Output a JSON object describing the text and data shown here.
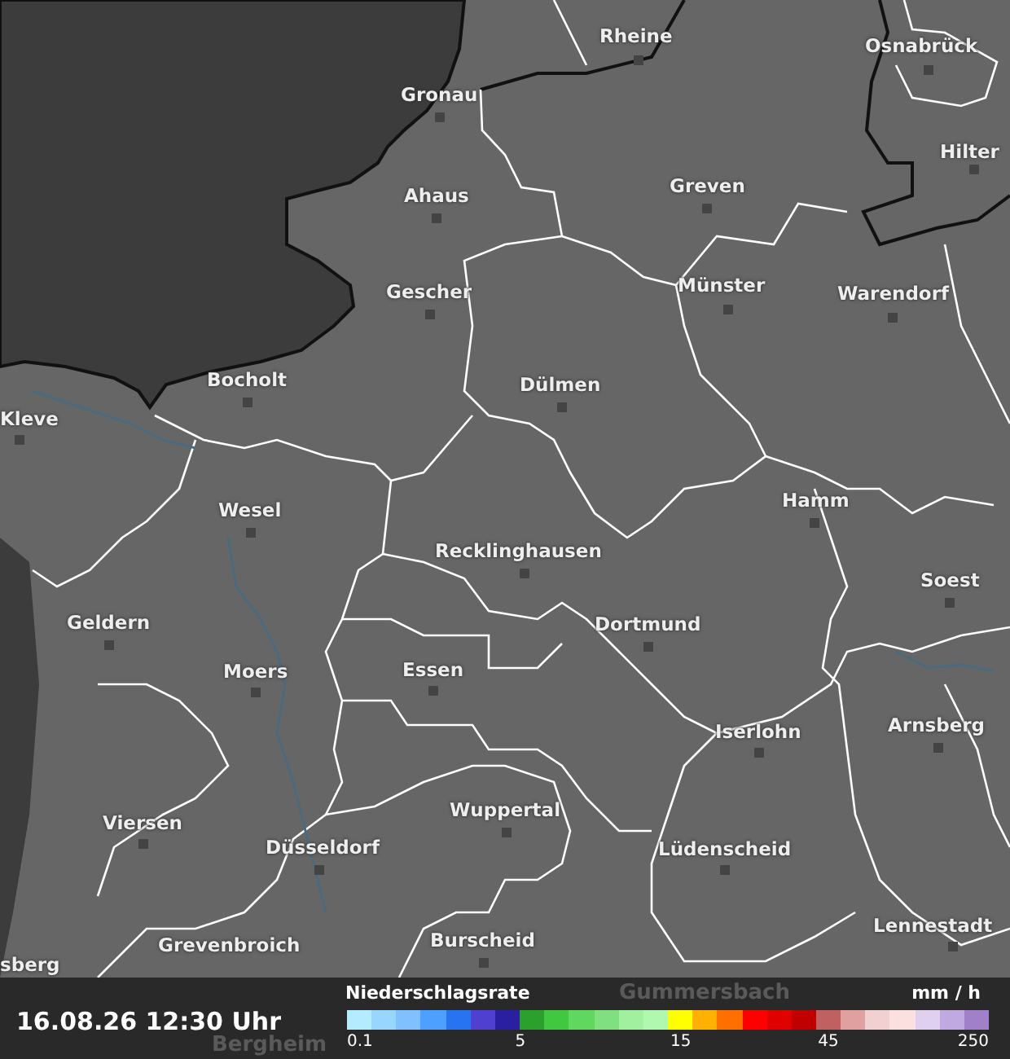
{
  "map": {
    "places": [
      {
        "name": "Rheine",
        "kind": "town"
      },
      {
        "name": "Osnabrück",
        "kind": "town"
      },
      {
        "name": "Gronau",
        "kind": "town"
      },
      {
        "name": "Hilter",
        "kind": "town"
      },
      {
        "name": "Ahaus",
        "kind": "town"
      },
      {
        "name": "Greven",
        "kind": "town"
      },
      {
        "name": "Gescher",
        "kind": "town"
      },
      {
        "name": "Münster",
        "kind": "town"
      },
      {
        "name": "Warendorf",
        "kind": "town"
      },
      {
        "name": "Bocholt",
        "kind": "town"
      },
      {
        "name": "Dülmen",
        "kind": "town"
      },
      {
        "name": "Kleve",
        "kind": "town"
      },
      {
        "name": "Wesel",
        "kind": "town"
      },
      {
        "name": "Hamm",
        "kind": "town"
      },
      {
        "name": "Recklinghausen",
        "kind": "town"
      },
      {
        "name": "Soest",
        "kind": "town"
      },
      {
        "name": "Geldern",
        "kind": "town"
      },
      {
        "name": "Dortmund",
        "kind": "town"
      },
      {
        "name": "Moers",
        "kind": "town"
      },
      {
        "name": "Essen",
        "kind": "town"
      },
      {
        "name": "Arnsberg",
        "kind": "town"
      },
      {
        "name": "Iserlohn",
        "kind": "town"
      },
      {
        "name": "Wuppertal",
        "kind": "town"
      },
      {
        "name": "Viersen",
        "kind": "town"
      },
      {
        "name": "Düsseldorf",
        "kind": "town"
      },
      {
        "name": "Lüdenscheid",
        "kind": "town"
      },
      {
        "name": "Lennestadt",
        "kind": "town"
      },
      {
        "name": "Grevenbroich",
        "kind": "town"
      },
      {
        "name": "Burscheid",
        "kind": "town"
      },
      {
        "name": "sberg",
        "kind": "town"
      },
      {
        "name": "Gummersbach",
        "kind": "covered"
      },
      {
        "name": "Bergheim",
        "kind": "covered"
      }
    ]
  },
  "timestamp": "16.08.26 12:30 Uhr",
  "legend": {
    "title": "Niederschlagsrate",
    "unit": "mm / h",
    "swatches": [
      {
        "color": "#b3ecff"
      },
      {
        "color": "#99d6ff"
      },
      {
        "color": "#80c0ff"
      },
      {
        "color": "#4da0ff"
      },
      {
        "color": "#2873f0"
      },
      {
        "color": "#5040d0"
      },
      {
        "color": "#2a1fa0"
      },
      {
        "color": "#2ca02c"
      },
      {
        "color": "#40c840"
      },
      {
        "color": "#60d860"
      },
      {
        "color": "#80e080"
      },
      {
        "color": "#a0f0a0"
      },
      {
        "color": "#b0f8b0"
      },
      {
        "color": "#ffff00"
      },
      {
        "color": "#ffb000"
      },
      {
        "color": "#ff7000"
      },
      {
        "color": "#ff0000"
      },
      {
        "color": "#e00000"
      },
      {
        "color": "#c00000"
      },
      {
        "color": "#c06060"
      },
      {
        "color": "#e0a0a0"
      },
      {
        "color": "#f0d0d0"
      },
      {
        "color": "#fbe0e0"
      },
      {
        "color": "#e0d0f0"
      },
      {
        "color": "#c0a8e0"
      },
      {
        "color": "#a080c8"
      }
    ],
    "ticks": [
      "0.1",
      "5",
      "15",
      "45",
      "250"
    ]
  }
}
